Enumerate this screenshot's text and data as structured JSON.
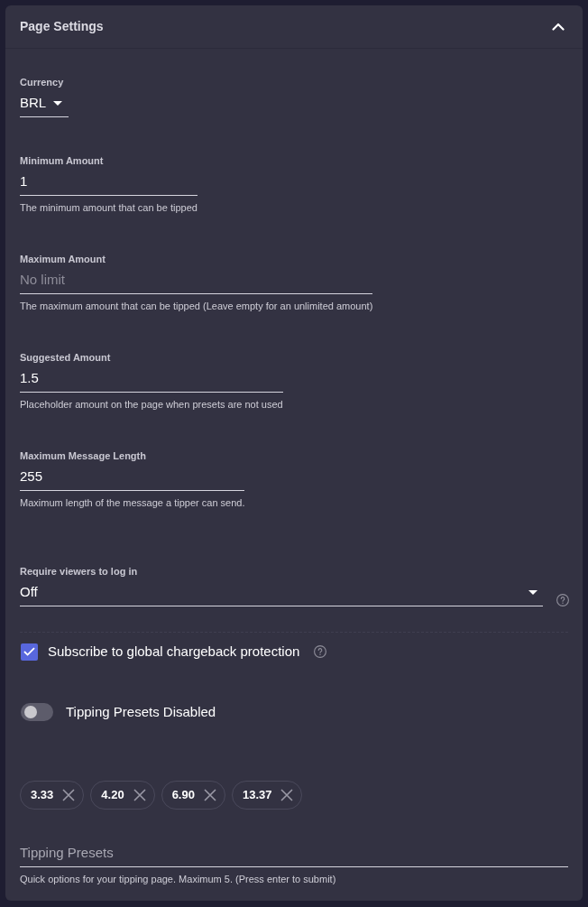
{
  "panel": {
    "title": "Page Settings",
    "expanded": true
  },
  "currency": {
    "label": "Currency",
    "value": "BRL"
  },
  "fields": [
    {
      "label": "Minimum Amount",
      "value": "1",
      "helper": "The minimum amount that can be tipped"
    },
    {
      "label": "Maximum Amount",
      "placeholder": "No limit",
      "helper": "The maximum amount that can be tipped (Leave empty for an unlimited amount)"
    },
    {
      "label": "Suggested Amount",
      "value": "1.5",
      "helper": "Placeholder amount on the page when presets are not used"
    },
    {
      "label": "Maximum Message Length",
      "value": "255",
      "helper": "Maximum length of the message a tipper can send."
    }
  ],
  "login_requirement": {
    "label": "Require viewers to log in",
    "value": "Off"
  },
  "chargeback": {
    "label": "Subscribe to global chargeback protection",
    "checked": true
  },
  "presets_toggle": {
    "label": "Tipping Presets Disabled",
    "on": false
  },
  "presets": [
    {
      "label": "3.33"
    },
    {
      "label": "4.20"
    },
    {
      "label": "6.90"
    },
    {
      "label": "13.37"
    }
  ],
  "preset_input": {
    "placeholder": "Tipping Presets",
    "helper": "Quick options for your tipping page. Maximum 5. (Press enter to submit)"
  }
}
